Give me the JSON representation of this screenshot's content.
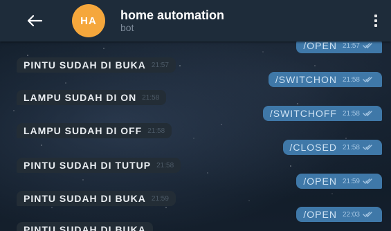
{
  "header": {
    "back_icon": "arrow-left-icon",
    "avatar_text": "HA",
    "avatar_color": "#f5a73c",
    "title": "home automation",
    "subtitle": "bot",
    "menu_icon": "kebab-menu-icon"
  },
  "messages": [
    {
      "dir": "out",
      "text": "/OPEN",
      "time": "21:57"
    },
    {
      "dir": "in",
      "text": "PINTU SUDAH DI BUKA",
      "time": "21:57"
    },
    {
      "dir": "out",
      "text": "/SWITCHON",
      "time": "21:58"
    },
    {
      "dir": "in",
      "text": "LAMPU SUDAH DI ON",
      "time": "21:58"
    },
    {
      "dir": "out",
      "text": "/SWITCHOFF",
      "time": "21:58"
    },
    {
      "dir": "in",
      "text": "LAMPU SUDAH DI OFF",
      "time": "21:58"
    },
    {
      "dir": "out",
      "text": "/CLOSED",
      "time": "21:58"
    },
    {
      "dir": "in",
      "text": "PINTU SUDAH DI TUTUP",
      "time": "21:58"
    },
    {
      "dir": "out",
      "text": "/OPEN",
      "time": "21:59"
    },
    {
      "dir": "in",
      "text": "PINTU SUDAH DI BUKA",
      "time": "21:59"
    },
    {
      "dir": "out",
      "text": "/OPEN",
      "time": "22:03"
    },
    {
      "dir": "in",
      "text": "PINTU SUDAH DI BUKA",
      "time": ""
    }
  ],
  "colors": {
    "header_bg": "#1e2c3a",
    "outgoing_bubble": "#3f78a8",
    "incoming_bubble": "#232d36"
  }
}
